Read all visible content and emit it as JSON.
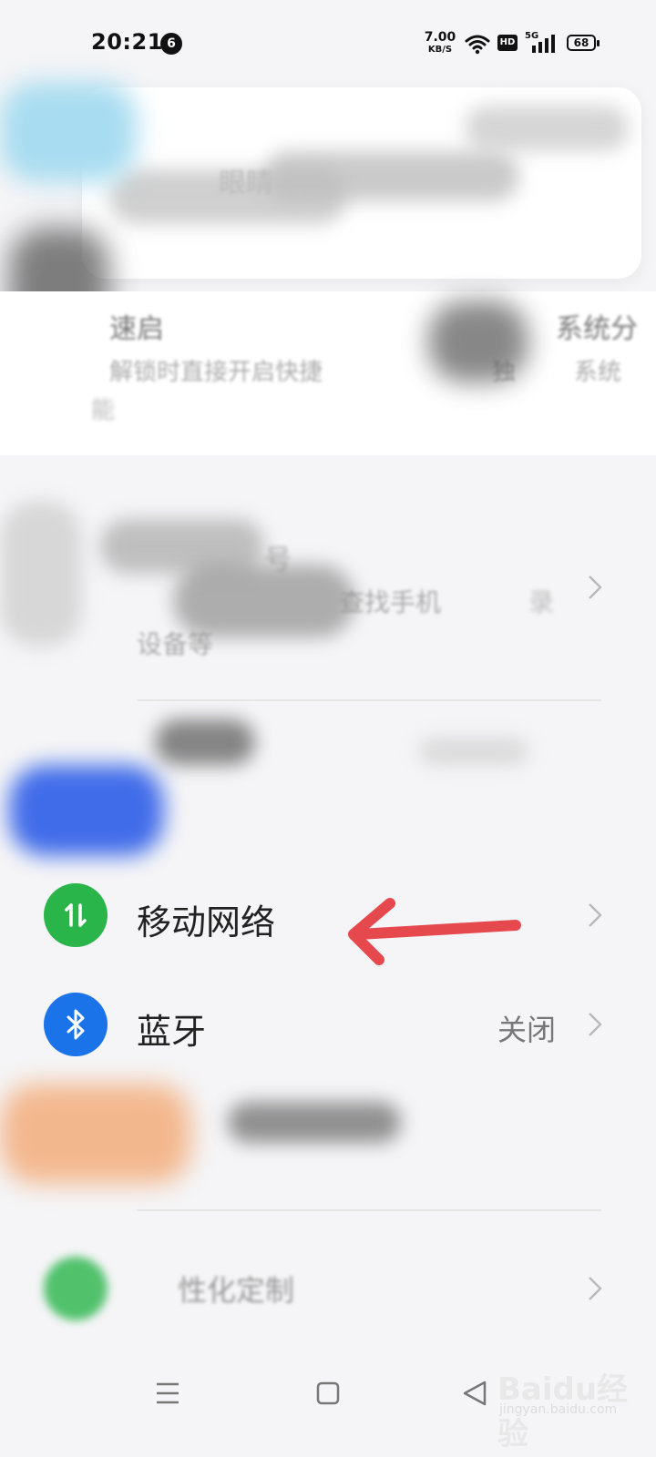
{
  "status_bar": {
    "time": "20:21",
    "notification_count": "6",
    "net_speed_value": "7.00",
    "net_speed_unit": "KB/S",
    "hd_label": "HD",
    "network_type": "5G",
    "battery_level": "68"
  },
  "blurred_texts": {
    "card_text": "眼睛",
    "left_title": "速启",
    "left_desc1": "解锁时直接开启快捷",
    "left_desc2": "能",
    "right_title": "系统分",
    "right_desc1": "独",
    "right_desc2": "系统",
    "mid_desc": "查找手机",
    "mid_desc2": "录",
    "mid_desc3": "设备等",
    "mid_char": "号",
    "bottom_label": "性化定制"
  },
  "settings": [
    {
      "label": "移动网络",
      "value": "",
      "icon": "mobile-data-icon",
      "color": "#29b54a"
    },
    {
      "label": "蓝牙",
      "value": "关闭",
      "icon": "bluetooth-icon",
      "color": "#1a73e8"
    }
  ],
  "colors": {
    "accent_arrow": "#e5484d"
  },
  "watermark": {
    "brand": "Baidu经验",
    "sub": "jingyan.baidu.com"
  }
}
